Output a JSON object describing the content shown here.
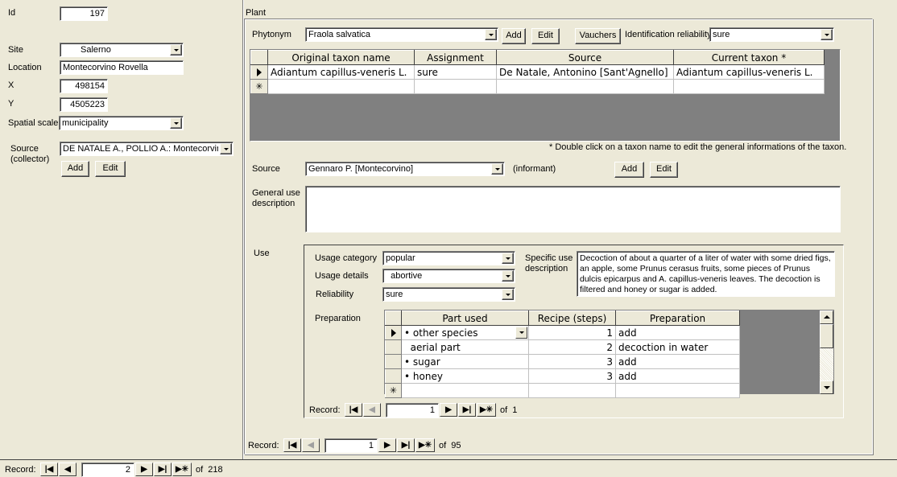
{
  "left": {
    "id_label": "Id",
    "id_value": "197",
    "site_label": "Site",
    "site_value": "Salerno",
    "location_label": "Location",
    "location_value": "Montecorvino Rovella",
    "x_label": "X",
    "x_value": "498154",
    "y_label": "Y",
    "y_value": "4505223",
    "spatial_scale_label": "Spatial scale",
    "spatial_scale_value": "municipality",
    "source_label_1": "Source",
    "source_label_2": "(collector)",
    "source_value": "DE NATALE A., POLLIO A.: Montecorvino",
    "add_label": "Add",
    "edit_label": "Edit"
  },
  "plant": {
    "title": "Plant",
    "phytonym_label": "Phytonym",
    "phytonym_value": "Fraola salvatica",
    "add_label": "Add",
    "edit_label": "Edit",
    "vauchers_label": "Vauchers",
    "id_reliability_label": "Identification reliability",
    "id_reliability_value": "sure",
    "taxon_grid": {
      "columns": [
        "Original taxon name",
        "Assignment",
        "Source",
        "Current taxon *"
      ],
      "rows": [
        [
          "Adiantum capillus-veneris L.",
          "sure",
          "De Natale, Antonino [Sant'Agnello]",
          "Adiantum capillus-veneris L."
        ]
      ]
    },
    "note": "* Double click on a taxon name to edit the general informations of the taxon.",
    "source_label": "Source",
    "source_value": "Gennaro P. [Montecorvino]",
    "informant_label": "(informant)",
    "source_add_label": "Add",
    "source_edit_label": "Edit",
    "general_use_label_1": "General use",
    "general_use_label_2": "description",
    "general_use_value": "",
    "use_label": "Use",
    "record_nav": {
      "label": "Record:",
      "current": "1",
      "of_text": "of  95"
    }
  },
  "use": {
    "usage_category_label": "Usage category",
    "usage_category_value": "popular",
    "usage_details_label": "Usage details",
    "usage_details_value": "  abortive",
    "reliability_label": "Reliability",
    "reliability_value": "sure",
    "specific_use_label_1": "Specific use",
    "specific_use_label_2": "description",
    "specific_use_value": "Decoction of about a quarter of a liter of water with some dried figs, an apple, some Prunus cerasus fruits, some pieces of Prunus dulcis epicarpus and A. capillus-veneris leaves. The decoction is filtered and honey or sugar is added.",
    "preparation_label": "Preparation",
    "prep_grid": {
      "columns": [
        "Part used",
        "Recipe (steps)",
        "Preparation"
      ],
      "rows": [
        {
          "part": "• other species",
          "steps": "1",
          "prep": "add"
        },
        {
          "part": "  aerial part",
          "steps": "2",
          "prep": "decoction in water"
        },
        {
          "part": "• sugar",
          "steps": "3",
          "prep": "add"
        },
        {
          "part": "• honey",
          "steps": "3",
          "prep": "add"
        }
      ]
    },
    "record_nav": {
      "label": "Record:",
      "current": "1",
      "of_text": "of  1"
    }
  },
  "main_record_nav": {
    "label": "Record:",
    "current": "2",
    "of_text": "of  218"
  },
  "icons": {
    "first": "first-record-icon",
    "prev": "prev-record-icon",
    "next": "next-record-icon",
    "last": "last-record-icon",
    "new": "new-record-icon"
  }
}
